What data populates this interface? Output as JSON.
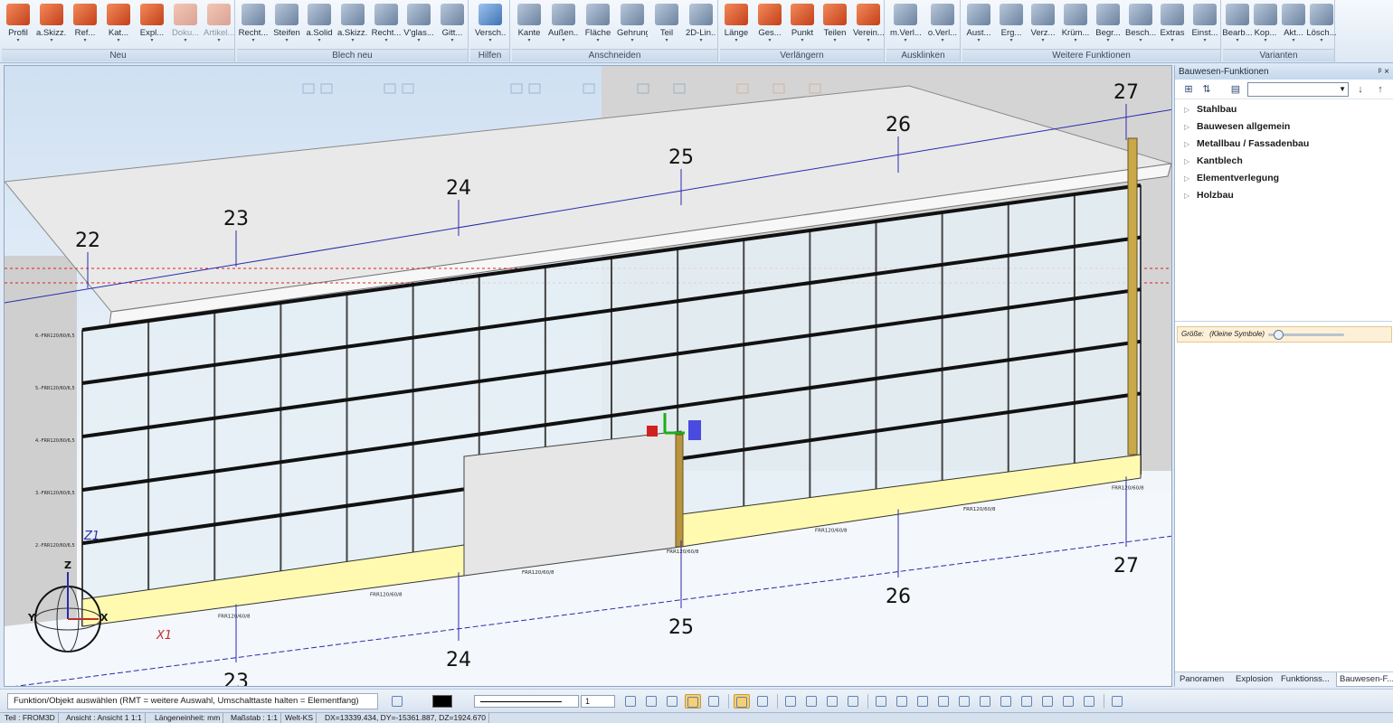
{
  "ribbon": {
    "groups": [
      {
        "title": "Neu",
        "buttons": [
          {
            "label": "Profil",
            "icon": "profile-icon",
            "dim": false
          },
          {
            "label": "a.Skizz...",
            "icon": "sketch-profile-icon",
            "dim": false
          },
          {
            "label": "Ref...",
            "icon": "reference-icon",
            "dim": false
          },
          {
            "label": "Kat...",
            "icon": "catalog-icon",
            "dim": false
          },
          {
            "label": "Expl...",
            "icon": "explorer-icon",
            "dim": false
          },
          {
            "label": "Doku...",
            "icon": "documentation-icon",
            "dim": true
          },
          {
            "label": "Artikel...",
            "icon": "article-icon",
            "dim": true
          }
        ]
      },
      {
        "title": "Blech neu",
        "buttons": [
          {
            "label": "Recht...",
            "icon": "rect-sheet-icon",
            "dim": false
          },
          {
            "label": "Steifen",
            "icon": "stiffener-icon",
            "dim": false
          },
          {
            "label": "a.Solid",
            "icon": "from-solid-icon",
            "dim": false
          },
          {
            "label": "a.Skizz...",
            "icon": "sheet-sketch-icon",
            "dim": false
          },
          {
            "label": "Recht...",
            "icon": "rect-plate-icon",
            "dim": false
          },
          {
            "label": "V'glas...",
            "icon": "glazing-icon",
            "dim": false
          },
          {
            "label": "Gitt...",
            "icon": "grating-icon",
            "dim": false
          }
        ]
      },
      {
        "title": "Hilfen",
        "buttons": [
          {
            "label": "Versch...",
            "icon": "helpers-icon",
            "dim": false
          }
        ]
      },
      {
        "title": "Anschneiden",
        "buttons": [
          {
            "label": "Kante",
            "icon": "cut-edge-icon",
            "dim": false
          },
          {
            "label": "Außen...",
            "icon": "cut-outer-icon",
            "dim": false
          },
          {
            "label": "Fläche",
            "icon": "cut-surface-icon",
            "dim": false
          },
          {
            "label": "Gehrung",
            "icon": "miter-icon",
            "dim": false
          },
          {
            "label": "Teil",
            "icon": "cut-part-icon",
            "dim": false
          },
          {
            "label": "2D-Lin...",
            "icon": "cut-2d-line-icon",
            "dim": false
          }
        ]
      },
      {
        "title": "Verlängern",
        "buttons": [
          {
            "label": "Länge",
            "icon": "extend-length-icon",
            "dim": false
          },
          {
            "label": "Ges...",
            "icon": "extend-total-icon",
            "dim": false
          },
          {
            "label": "Punkt",
            "icon": "extend-point-icon",
            "dim": false
          },
          {
            "label": "Teilen",
            "icon": "split-icon",
            "dim": false
          },
          {
            "label": "Verein...",
            "icon": "merge-icon",
            "dim": false
          }
        ]
      },
      {
        "title": "Ausklinken",
        "buttons": [
          {
            "label": "m.Verl...",
            "icon": "notch-extend-icon",
            "dim": false
          },
          {
            "label": "o.Verl...",
            "icon": "notch-no-extend-icon",
            "dim": false
          }
        ]
      },
      {
        "title": "Weitere Funktionen",
        "buttons": [
          {
            "label": "Aust...",
            "icon": "replace-icon",
            "dim": false
          },
          {
            "label": "Erg...",
            "icon": "supplement-icon",
            "dim": false
          },
          {
            "label": "Verz...",
            "icon": "distort-icon",
            "dim": false
          },
          {
            "label": "Krüm...",
            "icon": "curve-icon",
            "dim": false
          },
          {
            "label": "Begr...",
            "icon": "limit-icon",
            "dim": false
          },
          {
            "label": "Besch...",
            "icon": "fitting-icon",
            "dim": false
          },
          {
            "label": "Extras",
            "icon": "extras-icon",
            "dim": false
          },
          {
            "label": "Einst...",
            "icon": "settings-icon",
            "dim": false
          }
        ]
      },
      {
        "title": "Varianten",
        "buttons": [
          {
            "label": "Bearb...",
            "icon": "edit-variant-icon",
            "dim": false
          },
          {
            "label": "Kop...",
            "icon": "copy-variant-icon",
            "dim": false
          },
          {
            "label": "Akt...",
            "icon": "update-variant-icon",
            "dim": false
          },
          {
            "label": "Lösch...",
            "icon": "delete-variant-icon",
            "dim": false
          }
        ]
      }
    ]
  },
  "viewport": {
    "grid_labels_top": [
      "22",
      "23",
      "24",
      "25",
      "26",
      "27"
    ],
    "grid_labels_bottom": [
      "23",
      "24",
      "25",
      "26",
      "27"
    ],
    "axis_labels": {
      "z1": "Z1",
      "x1": "X1"
    },
    "level_labels": [
      "6.-FRR120/60/6,5",
      "5.-FRR120/60/6,5",
      "4.-FRR120/60/6,5",
      "3.-FRR120/60/6,5",
      "2.-FRR120/60/6,5"
    ],
    "panel_tags": [
      "FRR120/60/8",
      "FRR120/60/8",
      "FRR120/60/8",
      "FRR120/60/8",
      "FRR120/60/8",
      "FRR120/60/8",
      "FRR120/60/8"
    ],
    "nav_cube": {
      "z": "Z",
      "y": "Y",
      "x": "X"
    },
    "colors": {
      "grid": "#2a2ab0",
      "level_line": "#e02020",
      "spandrel": "#fffab0",
      "slab": "#e9e9e9",
      "frame": "#111111"
    }
  },
  "right_panel": {
    "title": "Bauwesen-Funktionen",
    "pin": "ᵖ ×",
    "search_value": "",
    "tree": [
      "Stahlbau",
      "Bauwesen allgemein",
      "Metallbau / Fassadenbau",
      "Kantblech",
      "Elementverlegung",
      "Holzbau"
    ],
    "size_label": "Größe:",
    "size_value": "(Kleine Symbole)",
    "tabs": [
      "Panoramen",
      "Explosion",
      "Funktionss...",
      "Bauwesen-F..."
    ],
    "active_tab": 3
  },
  "bottom_toolbar": {
    "prompt": "Funktion/Objekt auswählen (RMT = weitere Auswahl, Umschalttaste halten = Elementfang)",
    "line_weight": "1",
    "color": "#000000"
  },
  "status": [
    "Teil : FROM3D",
    "Ansicht : Ansicht 1 1:1",
    "Längeneinheit: mm",
    "Maßstab : 1:1",
    "Welt-KS",
    "DX=13339.434, DY=-15361.887, DZ=1924.670"
  ]
}
